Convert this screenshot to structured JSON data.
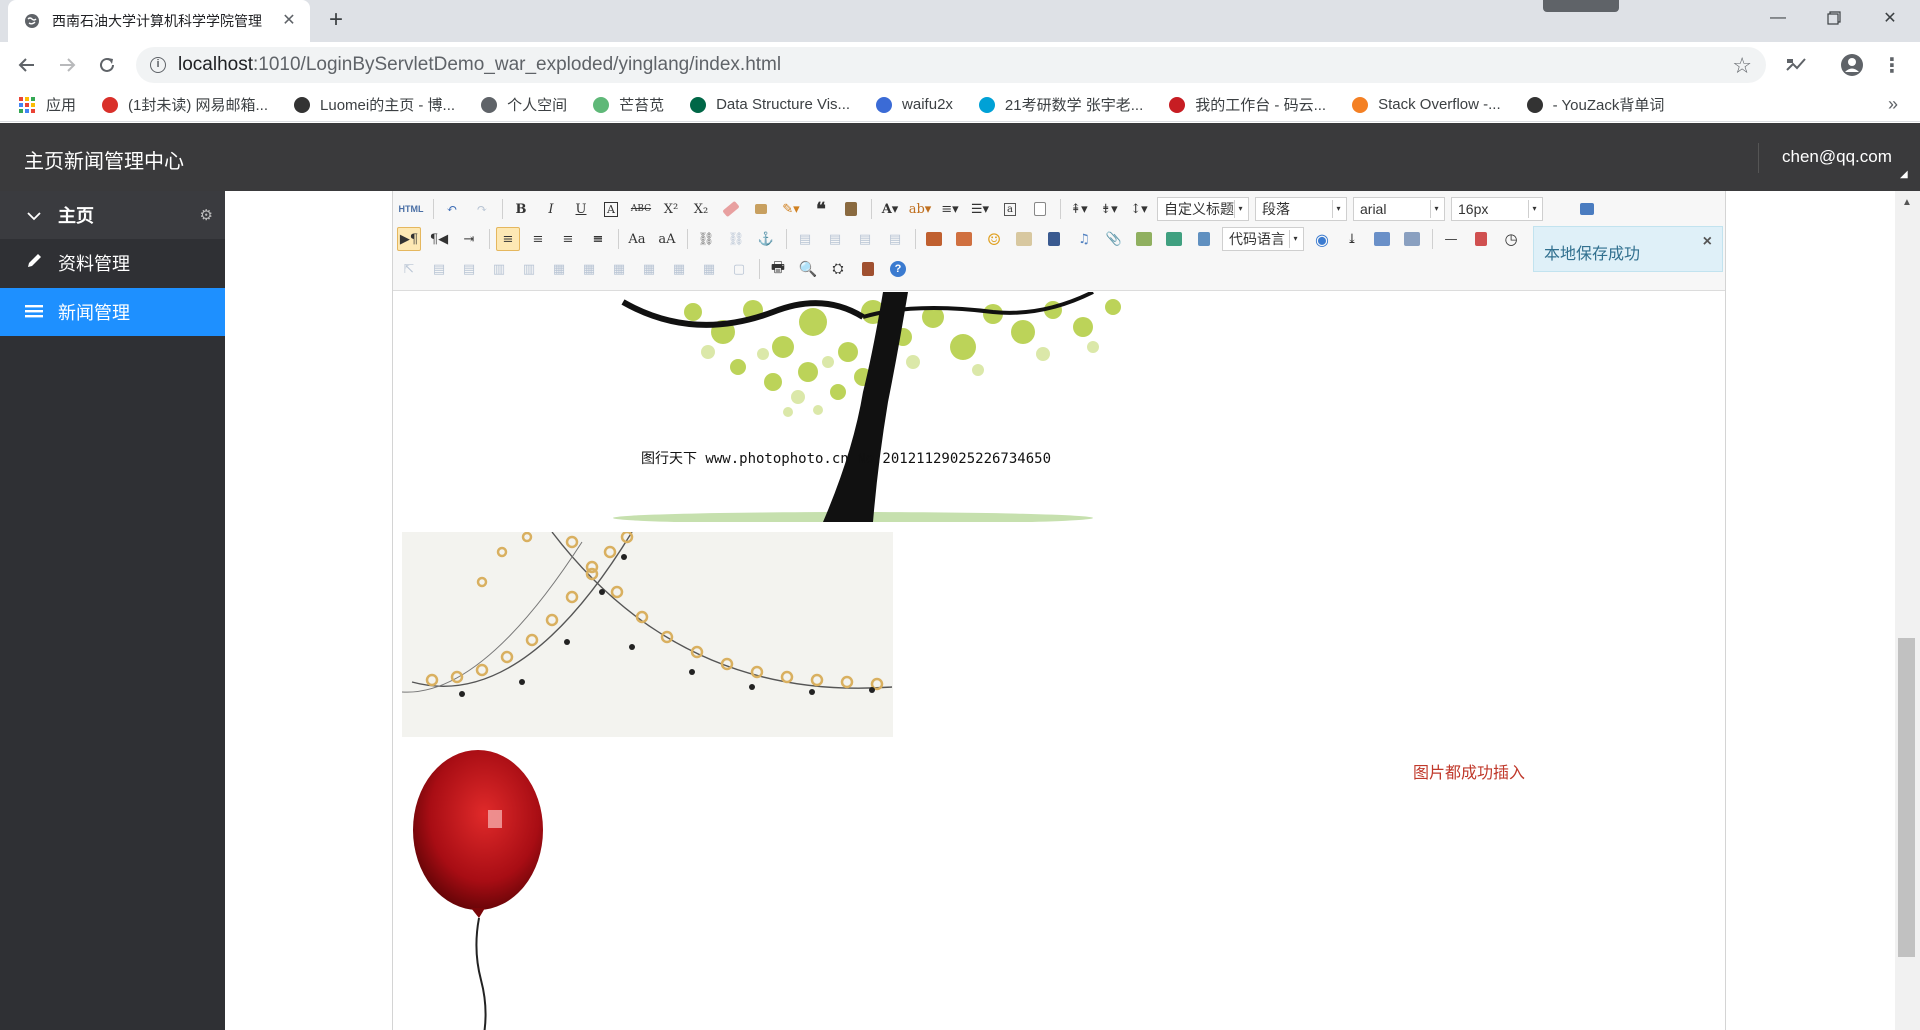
{
  "browser": {
    "tab_title": "西南石油大学计算机科学学院管理",
    "tab_close": "✕",
    "new_tab": "+",
    "url_host": "localhost",
    "url_path": ":1010/LoginByServletDemo_war_exploded/yinglang/index.html",
    "bookmarks": [
      {
        "label": "应用",
        "icon": "apps-grid-icon",
        "color": "#e94235"
      },
      {
        "label": "(1封未读) 网易邮箱...",
        "icon": "netease-mail-icon",
        "color": "#d9302a"
      },
      {
        "label": "Luomei的主页 - 博...",
        "icon": "luomei-icon",
        "color": "#333333"
      },
      {
        "label": "个人空间",
        "icon": "globe-icon",
        "color": "#5f6368"
      },
      {
        "label": "芒苔苋",
        "icon": "leaf-icon",
        "color": "#5fb878"
      },
      {
        "label": "Data Structure Vis...",
        "icon": "usf-icon",
        "color": "#006747"
      },
      {
        "label": "waifu2x",
        "icon": "waifu-icon",
        "color": "#3b6bd6"
      },
      {
        "label": "21考研数学 张宇老...",
        "icon": "bilibili-icon",
        "color": "#00a1d6"
      },
      {
        "label": "我的工作台 - 码云...",
        "icon": "gitee-icon",
        "color": "#c71d23"
      },
      {
        "label": "Stack Overflow -...",
        "icon": "stackoverflow-icon",
        "color": "#f48024"
      },
      {
        "label": "- YouZack背单词",
        "icon": "youzack-icon",
        "color": "#333333"
      }
    ],
    "bookmarks_more": "»"
  },
  "header": {
    "brand": "主页新闻管理中心",
    "user": "chen@qq.com"
  },
  "sidebar": {
    "items": [
      {
        "label": "主页",
        "icon": "chevron-down-icon"
      },
      {
        "label": "资料管理",
        "icon": "pencil-icon"
      },
      {
        "label": "新闻管理",
        "icon": "list-icon"
      }
    ]
  },
  "editor": {
    "font_style": "自定义标题",
    "paragraph": "段落",
    "font_family": "arial",
    "font_size": "16px",
    "code_language": "代码语言",
    "html_label": "HTML"
  },
  "notice": {
    "text": "本地保存成功",
    "close": "×"
  },
  "content": {
    "image_caption_cn": "图行天下",
    "image_caption_url": " www.photophoto.cn  No.20121129025226734650",
    "success_text": "图片都成功插入"
  },
  "colors": {
    "header_bg": "#3a3a3c",
    "sidebar_bg": "#2f3034",
    "active_item": "#1e90ff",
    "success_text": "#c0392b"
  }
}
